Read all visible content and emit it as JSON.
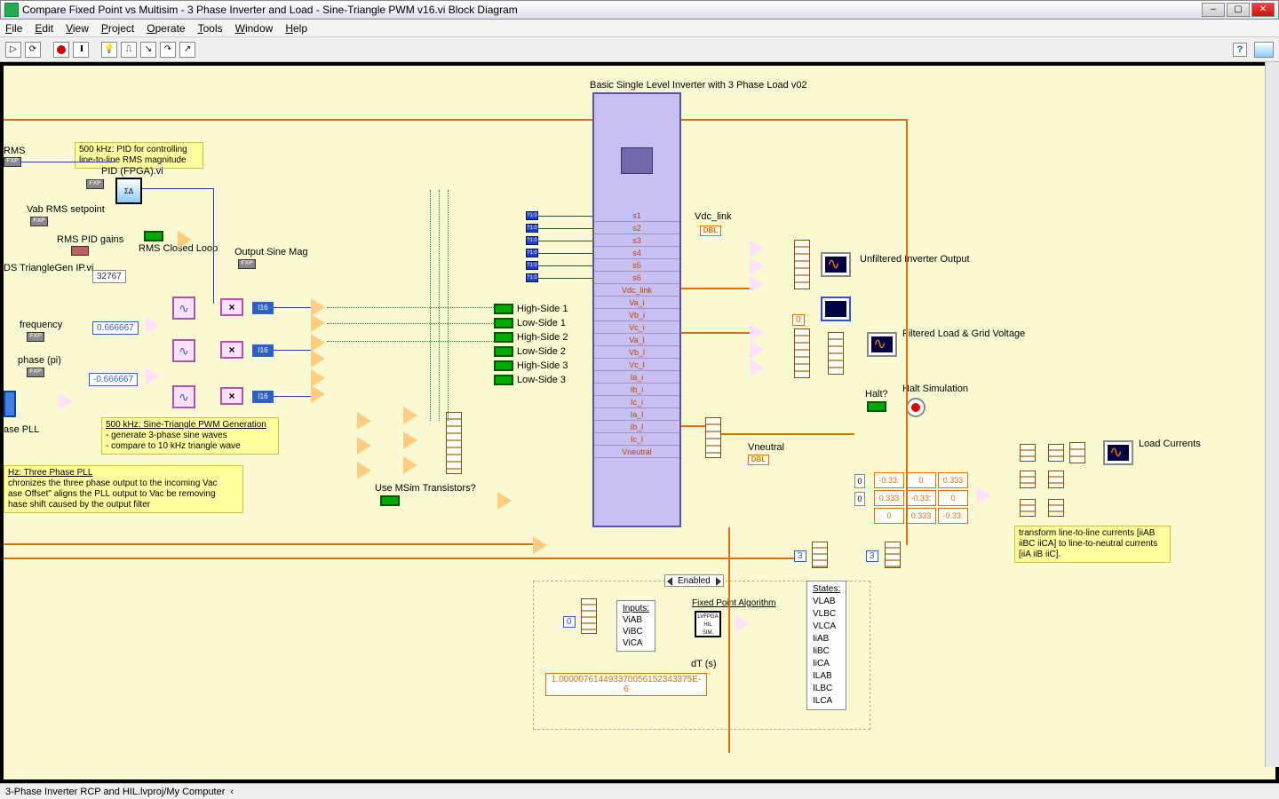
{
  "window": {
    "title": "Compare Fixed Point vs Multisim - 3 Phase Inverter and Load - Sine-Triangle PWM v16.vi Block Diagram"
  },
  "menu": {
    "file": "File",
    "edit": "Edit",
    "view": "View",
    "project": "Project",
    "operate": "Operate",
    "tools": "Tools",
    "window": "Window",
    "help": "Help"
  },
  "toolbar": {
    "run": "▷",
    "run_cont": "⟳",
    "pause": "II",
    "bulb": "💡",
    "help": "?"
  },
  "labels": {
    "top_subvi": "Basic Single Level Inverter with 3 Phase Load v02",
    "rms": "RMS",
    "pid_comment": "500 kHz: PID for controlling line-to-line RMS magnitude",
    "pid_subvi": "PID (FPGA).vi",
    "vab_setpoint": "Vab RMS setpoint",
    "rms_pid_gains": "RMS PID gains",
    "rms_closed_loop": "RMS Closed Loop",
    "output_sine_mag": "Output Sine Mag",
    "triangle_ip": "DS TriangleGen IP.vi",
    "frequency": "frequency",
    "phase": "phase (pi)",
    "phase_pll": "ase PLL",
    "pwm_comment_title": "500 kHz: Sine-Triangle PWM Generation",
    "pwm_comment_l1": "- generate 3-phase sine waves",
    "pwm_comment_l2": "- compare to 10 kHz triangle wave",
    "pll_comment_title": "Hz: Three Phase PLL",
    "pll_comment_l1": "chronizes the three phase output to the incoming Vac",
    "pll_comment_l2": "ase Offset\" aligns the PLL output to Vac be removing",
    "pll_comment_l3": "hase shift caused by the output filter",
    "hs1": "High-Side 1",
    "ls1": "Low-Side 1",
    "hs2": "High-Side 2",
    "ls2": "Low-Side 2",
    "hs3": "High-Side 3",
    "ls3": "Low-Side 3",
    "use_msim": "Use MSim Transistors?",
    "vdc_link": "Vdc_link",
    "unfiltered": "Unfiltered Inverter Output",
    "filtered": "Filtered Load &  Grid Voltage",
    "halt_q": "Halt?",
    "halt_sim": "Halt Simulation",
    "vneutral": "Vneutral",
    "load_currents": "Load Currents",
    "transform_comment": "transform line-to-line currents [iiAB iiBC iiCA] to line-to-neutral currents [iiA iiB iiC].",
    "enabled": "Enabled",
    "inputs": "Inputs:",
    "viab": "ViAB",
    "vibc": "ViBC",
    "vica": "ViCA",
    "fp_algo": "Fixed Point Algorithm",
    "dt": "dT (s)",
    "states": "States:",
    "fxp": "FXP",
    "i16": "I16",
    "dbl": "DBL",
    "p10": "?1:0"
  },
  "constants": {
    "c32767": "32767",
    "c0666": "0.666667",
    "cn0666": "-0.666667",
    "zero": "0",
    "three": "3",
    "dt_val": "1.000007614493370056152343375E-6"
  },
  "io_rows": [
    "s1",
    "s2",
    "s3",
    "s4",
    "s5",
    "s6",
    "Vdc_link",
    "Va_i",
    "Vb_i",
    "Vc_i",
    "Va_l",
    "Vb_l",
    "Vc_l",
    "Ia_i",
    "Ib_i",
    "Ic_i",
    "Ia_l",
    "Ib_l",
    "Ic_l",
    "Vneutral"
  ],
  "states_list": [
    "VLAB",
    "VLBC",
    "VLCA",
    "IiAB",
    "IiBC",
    "IiCA",
    "ILAB",
    "ILBC",
    "ILCA"
  ],
  "matrix": [
    "-0.33:",
    "0",
    "0.333",
    "0.333",
    "-0.33:",
    "0",
    "0",
    "0.333",
    "-0.33:"
  ],
  "statusbar": {
    "path": "3-Phase Inverter RCP and HIL.lvproj/My Computer",
    "arrow": "‹"
  }
}
